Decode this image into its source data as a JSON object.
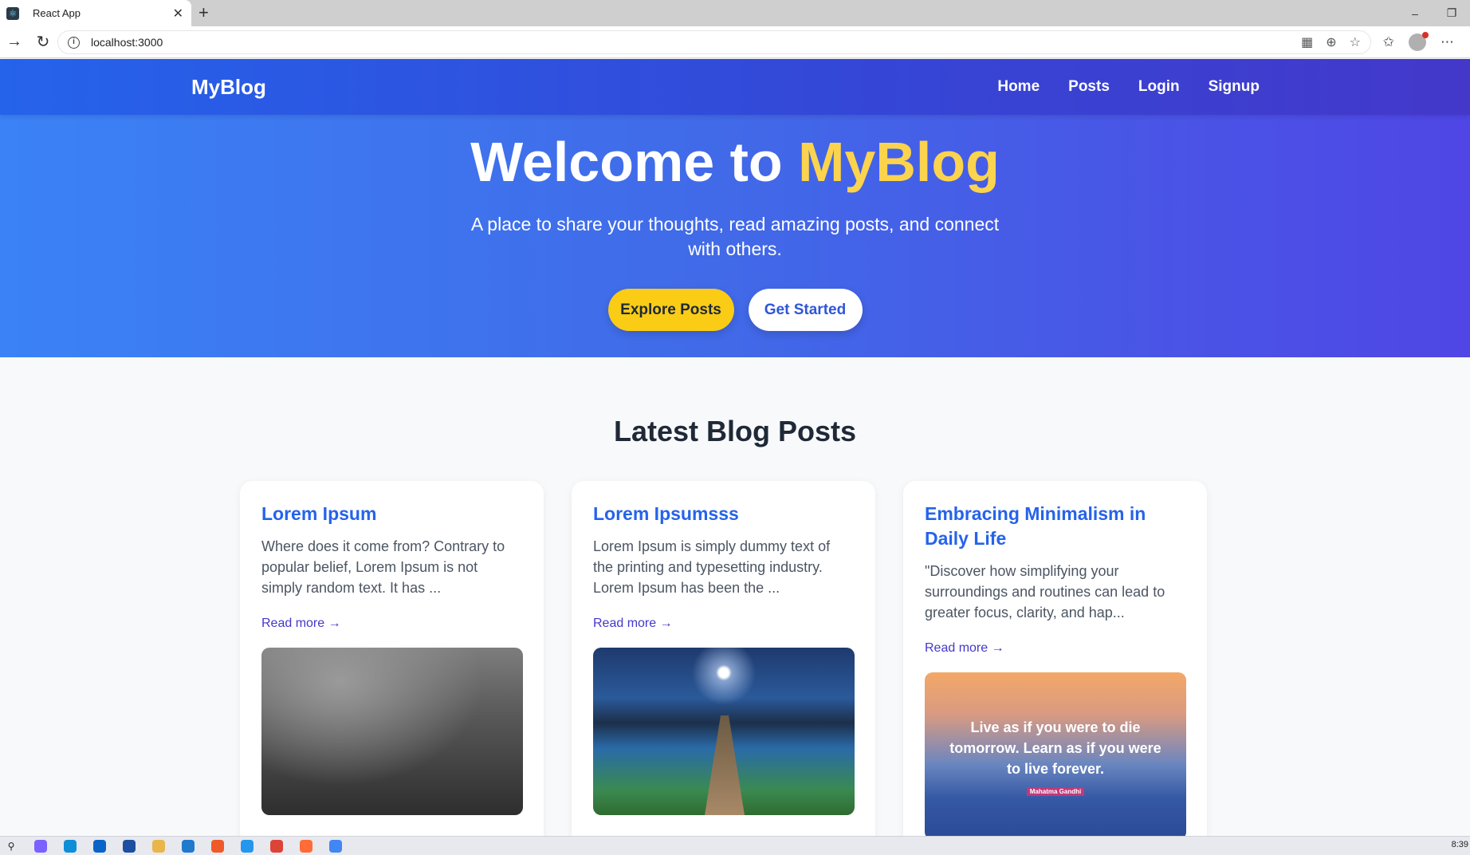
{
  "browser": {
    "tab_title": "React App",
    "url": "localhost:3000"
  },
  "site": {
    "brand": "MyBlog",
    "nav": [
      "Home",
      "Posts",
      "Login",
      "Signup"
    ]
  },
  "hero": {
    "title_prefix": "Welcome to ",
    "title_accent": "MyBlog",
    "subtitle": "A place to share your thoughts, read amazing posts, and connect with others.",
    "primary_button": "Explore Posts",
    "secondary_button": "Get Started"
  },
  "posts": {
    "section_title": "Latest Blog Posts",
    "items": [
      {
        "title": "Lorem Ipsum",
        "excerpt": "Where does it come from? Contrary to popular belief, Lorem Ipsum is not simply random text. It has ...",
        "read_more": "Read more →"
      },
      {
        "title": "Lorem Ipsumsss",
        "excerpt": "Lorem Ipsum is simply dummy text of the printing and typesetting industry. Lorem Ipsum has been the ...",
        "read_more": "Read more →"
      },
      {
        "title": "Embracing Minimalism in Daily Life",
        "excerpt": "\"Discover how simplifying your surroundings and routines can lead to greater focus, clarity, and hap...",
        "read_more": "Read more →",
        "image_quote": "Live as if you were to die tomorrow. Learn as if you were to live forever.",
        "image_author": "Mahatma Gandhi"
      }
    ]
  },
  "taskbar": {
    "clock": "8:39"
  },
  "colors": {
    "accent_yellow": "#facc15",
    "title_blue": "#2563eb",
    "link_indigo": "#4338ca"
  }
}
